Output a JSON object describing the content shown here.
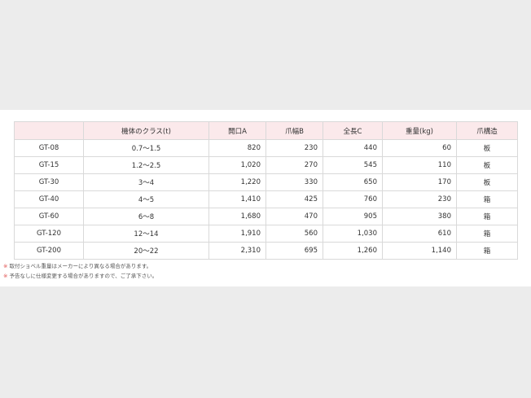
{
  "table": {
    "headers": [
      "",
      "機体のクラス(t)",
      "開口A",
      "爪幅B",
      "全長C",
      "重量(kg)",
      "爪構造"
    ],
    "rows": [
      [
        "GT-08",
        "0.7〜1.5",
        "820",
        "230",
        "440",
        "60",
        "板"
      ],
      [
        "GT-15",
        "1.2〜2.5",
        "1,020",
        "270",
        "545",
        "110",
        "板"
      ],
      [
        "GT-30",
        "3〜4",
        "1,220",
        "330",
        "650",
        "170",
        "板"
      ],
      [
        "GT-40",
        "4〜5",
        "1,410",
        "425",
        "760",
        "230",
        "箱"
      ],
      [
        "GT-60",
        "6〜8",
        "1,680",
        "470",
        "905",
        "380",
        "箱"
      ],
      [
        "GT-120",
        "12〜14",
        "1,910",
        "560",
        "1,030",
        "610",
        "箱"
      ],
      [
        "GT-200",
        "20〜22",
        "2,310",
        "695",
        "1,260",
        "1,140",
        "箱"
      ]
    ]
  },
  "notes": [
    {
      "mark": "※",
      "text": "取付ショベル重量はメーカーにより異なる場合があります。"
    },
    {
      "mark": "※",
      "text": "予告なしに仕様変更する場合がありますので、ご了承下さい。"
    }
  ],
  "colors": {
    "header_bg": "#fbe9eb",
    "note_mark": "#e0504f"
  }
}
